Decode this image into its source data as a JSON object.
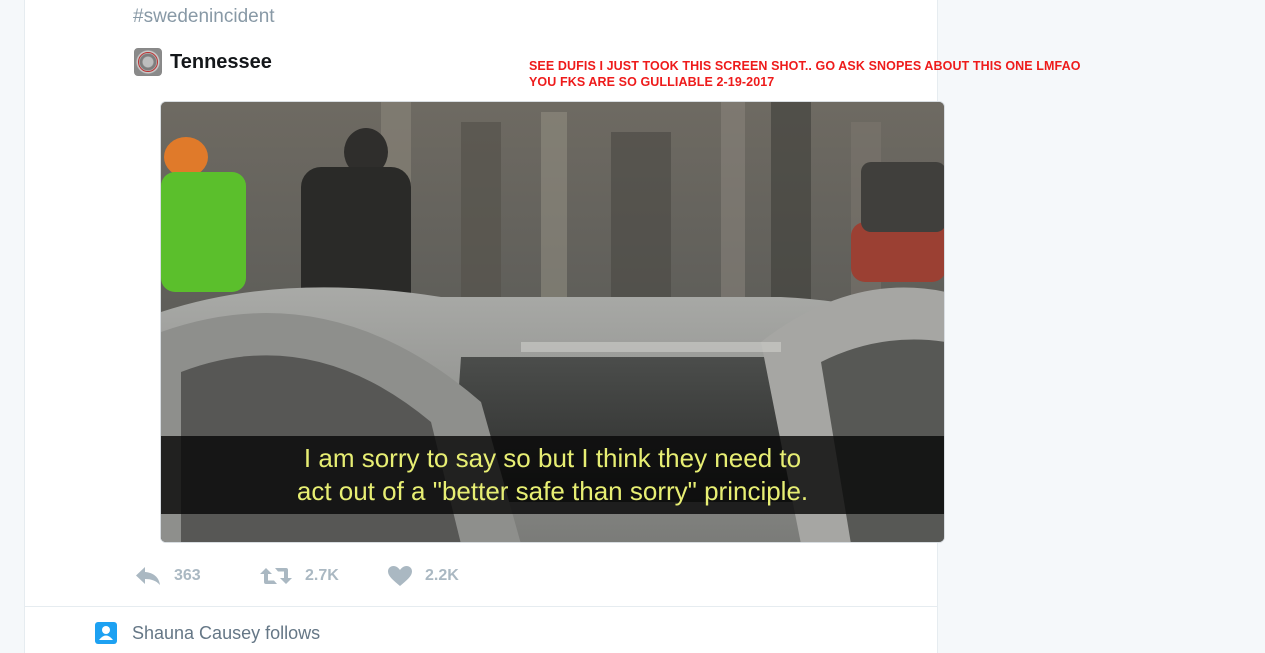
{
  "tweet": {
    "hashtag": "#swedenincident",
    "author": {
      "name": "Tennessee",
      "avatar_icon": "state-seal-avatar"
    },
    "media": {
      "subtitle_lines": [
        "I am sorry to say so but I think they need to",
        "act out of a \"better safe than sorry\" principle."
      ],
      "subtitle_color": "#e7ee73"
    },
    "actions": {
      "reply": {
        "icon": "reply-icon",
        "count": "363"
      },
      "retweet": {
        "icon": "retweet-icon",
        "count": "2.7K"
      },
      "like": {
        "icon": "heart-icon",
        "count": "2.2K"
      }
    }
  },
  "annotation": {
    "lines": [
      "SEE DUFIS I JUST TOOK THIS SCREEN SHOT.. GO ASK SNOPES ABOUT THIS ONE LMFAO",
      "YOU FKS ARE SO GULLIABLE  2-19-2017"
    ],
    "color": "#ee1b1b"
  },
  "next_item": {
    "icon": "follow-person-icon",
    "text": "Shauna Causey follows"
  },
  "colors": {
    "page_background": "#f5f8fa",
    "action_gray": "#aab8c2",
    "twitter_blue": "#1da1f2"
  }
}
